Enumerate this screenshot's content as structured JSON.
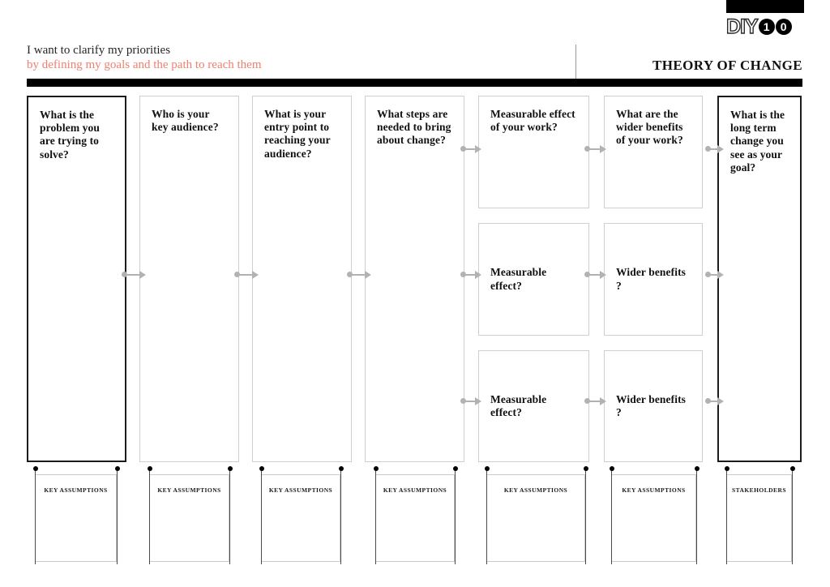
{
  "logo": {
    "wordmark": "DIY",
    "digit_one": "1",
    "digit_zero": "0"
  },
  "header": {
    "title": "I want to clarify my priorities",
    "subtitle": "by defining my goals and the path to reach them",
    "worksheet_title": "THEORY OF CHANGE",
    "accent_color": "#f0806f",
    "rule_color": "#000000"
  },
  "board": {
    "cards": [
      {
        "id": "problem",
        "label": "What is the problem you are trying to solve?",
        "emphasis": "primary",
        "row": 1,
        "column": 1
      },
      {
        "id": "audience",
        "label": "Who is your key audience?",
        "emphasis": "normal",
        "row": 1,
        "column": 2
      },
      {
        "id": "entry-point",
        "label": "What is your entry point to reaching your audience?",
        "emphasis": "normal",
        "row": 1,
        "column": 3
      },
      {
        "id": "steps",
        "label": "What steps are needed to bring about change?",
        "emphasis": "normal",
        "row": 1,
        "column": 4
      },
      {
        "id": "effect-1",
        "label": "Measurable effect of your work?",
        "emphasis": "normal",
        "row": 1,
        "column": 5
      },
      {
        "id": "benefits-1",
        "label": "What are the wider benefits of your work?",
        "emphasis": "normal",
        "row": 1,
        "column": 6
      },
      {
        "id": "long-term",
        "label": "What is the long term change you see as your goal?",
        "emphasis": "primary",
        "row": 1,
        "column": 7
      },
      {
        "id": "effect-2",
        "label": "Measurable effect?",
        "emphasis": "normal",
        "row": 2,
        "column": 5
      },
      {
        "id": "benefits-2",
        "label": "Wider benefits ?",
        "emphasis": "normal",
        "row": 2,
        "column": 6
      },
      {
        "id": "effect-3",
        "label": "Measurable effect?",
        "emphasis": "normal",
        "row": 3,
        "column": 5
      },
      {
        "id": "benefits-3",
        "label": "Wider benefits ?",
        "emphasis": "normal",
        "row": 3,
        "column": 6
      }
    ],
    "connector_color": "#b2b2b2",
    "notes": [
      {
        "id": "note-1",
        "label": "KEY ASSUMPTIONS"
      },
      {
        "id": "note-2",
        "label": "KEY ASSUMPTIONS"
      },
      {
        "id": "note-3",
        "label": "KEY ASSUMPTIONS"
      },
      {
        "id": "note-4",
        "label": "KEY ASSUMPTIONS"
      },
      {
        "id": "note-5",
        "label": "KEY ASSUMPTIONS"
      },
      {
        "id": "note-6",
        "label": "KEY ASSUMPTIONS"
      },
      {
        "id": "note-7",
        "label": "STAKEHOLDERS"
      }
    ]
  }
}
